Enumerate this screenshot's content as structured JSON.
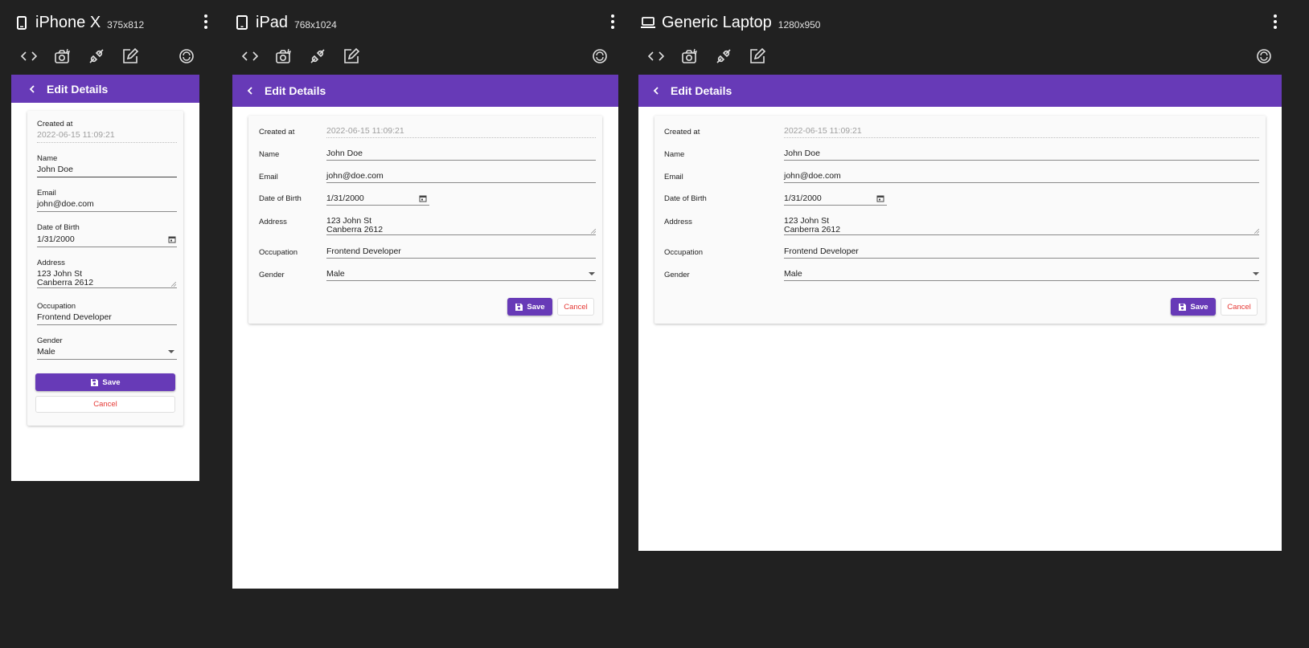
{
  "devices": [
    {
      "name": "iPhone X",
      "size": "375x812",
      "icon": "phone-icon"
    },
    {
      "name": "iPad",
      "size": "768x1024",
      "icon": "tablet-icon"
    },
    {
      "name": "Generic Laptop",
      "size": "1280x950",
      "icon": "laptop-icon"
    }
  ],
  "toolbar_icons": [
    "code-icon",
    "camera-icon",
    "plug-icon",
    "edit-icon",
    "rotate-icon"
  ],
  "app": {
    "title": "Edit Details",
    "accent_color": "#673ab7",
    "cancel_color": "#e53935"
  },
  "form": {
    "created_at": {
      "label": "Created at",
      "value": "2022-06-15 11:09:21"
    },
    "name": {
      "label": "Name",
      "value": "John Doe"
    },
    "email": {
      "label": "Email",
      "value": "john@doe.com"
    },
    "dob": {
      "label": "Date of Birth",
      "value": "1/31/2000"
    },
    "address": {
      "label": "Address",
      "line1": "123 John St",
      "line2": "Canberra 2612"
    },
    "occupation": {
      "label": "Occupation",
      "value": "Frontend Developer"
    },
    "gender": {
      "label": "Gender",
      "value": "Male"
    },
    "save_label": "Save",
    "cancel_label": "Cancel"
  }
}
